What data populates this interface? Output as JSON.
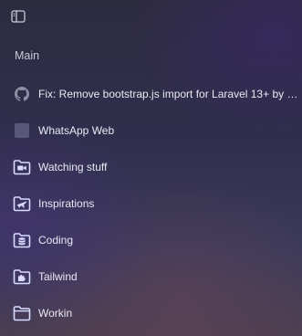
{
  "sidebar": {
    "section_title": "Main",
    "items": [
      {
        "label": "Fix: Remove bootstrap.js import for Laravel 13+ by …",
        "icon": "github-icon"
      },
      {
        "label": "WhatsApp Web",
        "icon": "whatsapp-favicon-placeholder"
      },
      {
        "label": "Watching stuff",
        "icon": "folder-video-icon"
      },
      {
        "label": "Inspirations",
        "icon": "folder-plane-icon"
      },
      {
        "label": "Coding",
        "icon": "folder-database-icon"
      },
      {
        "label": "Tailwind",
        "icon": "folder-puzzle-icon"
      },
      {
        "label": "Workin",
        "icon": "folder-icon"
      }
    ]
  },
  "colors": {
    "folder_icon": "#d9dcff",
    "text": "#e9e9f3",
    "muted_text": "#c9c9d6"
  }
}
